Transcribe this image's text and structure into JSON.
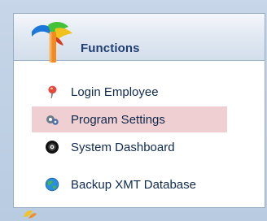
{
  "panel": {
    "title": "Functions"
  },
  "menu": {
    "items": [
      {
        "label": "Login Employee",
        "icon": "user-pin-icon"
      },
      {
        "label": "Program Settings",
        "icon": "settings-gears-icon"
      },
      {
        "label": "System Dashboard",
        "icon": "dashboard-disc-icon"
      },
      {
        "label": "Backup XMT Database",
        "icon": "database-globe-icon"
      }
    ],
    "selected_index": 1
  },
  "colors": {
    "background": "#b8cbe1",
    "header_text": "#1f3f73",
    "selected_row": "#efcfd2"
  }
}
